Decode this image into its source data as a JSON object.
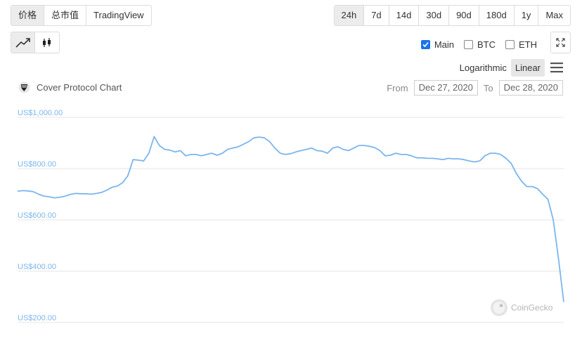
{
  "tabs": [
    {
      "label": "价格",
      "active": true
    },
    {
      "label": "总市值",
      "active": false
    },
    {
      "label": "TradingView",
      "active": false
    }
  ],
  "ranges": [
    {
      "label": "24h",
      "active": true
    },
    {
      "label": "7d",
      "active": false
    },
    {
      "label": "14d",
      "active": false
    },
    {
      "label": "30d",
      "active": false
    },
    {
      "label": "90d",
      "active": false
    },
    {
      "label": "180d",
      "active": false
    },
    {
      "label": "1y",
      "active": false
    },
    {
      "label": "Max",
      "active": false
    }
  ],
  "compare": [
    {
      "label": "Main",
      "checked": true
    },
    {
      "label": "BTC",
      "checked": false
    },
    {
      "label": "ETH",
      "checked": false
    }
  ],
  "scale": {
    "log_label": "Logarithmic",
    "linear_label": "Linear",
    "active": "linear"
  },
  "date_range": {
    "from_label": "From",
    "from_value": "Dec 27, 2020",
    "to_label": "To",
    "to_value": "Dec 28, 2020"
  },
  "credit": "CoinGecko",
  "colors": {
    "line": "#7cb5ec",
    "grid": "#e6e6e6",
    "accent": "#1a73e8"
  },
  "chart_data": {
    "type": "line",
    "title": "Cover Protocol Chart",
    "xlabel": "",
    "ylabel": "",
    "ylim": [
      200,
      1000
    ],
    "yticks": [
      200,
      400,
      600,
      800,
      1000
    ],
    "ytick_labels": [
      "US$200.00",
      "US$400.00",
      "US$600.00",
      "US$800.00",
      "US$1,000.00"
    ],
    "grid": true,
    "series": [
      {
        "values": [
          712,
          714,
          713,
          710,
          700,
          693,
          690,
          686,
          688,
          692,
          699,
          703,
          702,
          702,
          700,
          703,
          707,
          716,
          727,
          732,
          745,
          772,
          835,
          833,
          830,
          860,
          925,
          890,
          875,
          872,
          865,
          870,
          850,
          855,
          855,
          850,
          855,
          860,
          852,
          860,
          875,
          880,
          885,
          895,
          905,
          920,
          923,
          920,
          905,
          880,
          860,
          855,
          858,
          865,
          870,
          875,
          880,
          870,
          868,
          860,
          880,
          885,
          875,
          870,
          880,
          890,
          890,
          887,
          882,
          870,
          850,
          852,
          860,
          855,
          855,
          850,
          842,
          842,
          840,
          840,
          838,
          835,
          840,
          838,
          838,
          835,
          830,
          826,
          830,
          850,
          860,
          860,
          855,
          840,
          820,
          780,
          750,
          730,
          730,
          722,
          700,
          680,
          600,
          450,
          280
        ]
      }
    ]
  }
}
